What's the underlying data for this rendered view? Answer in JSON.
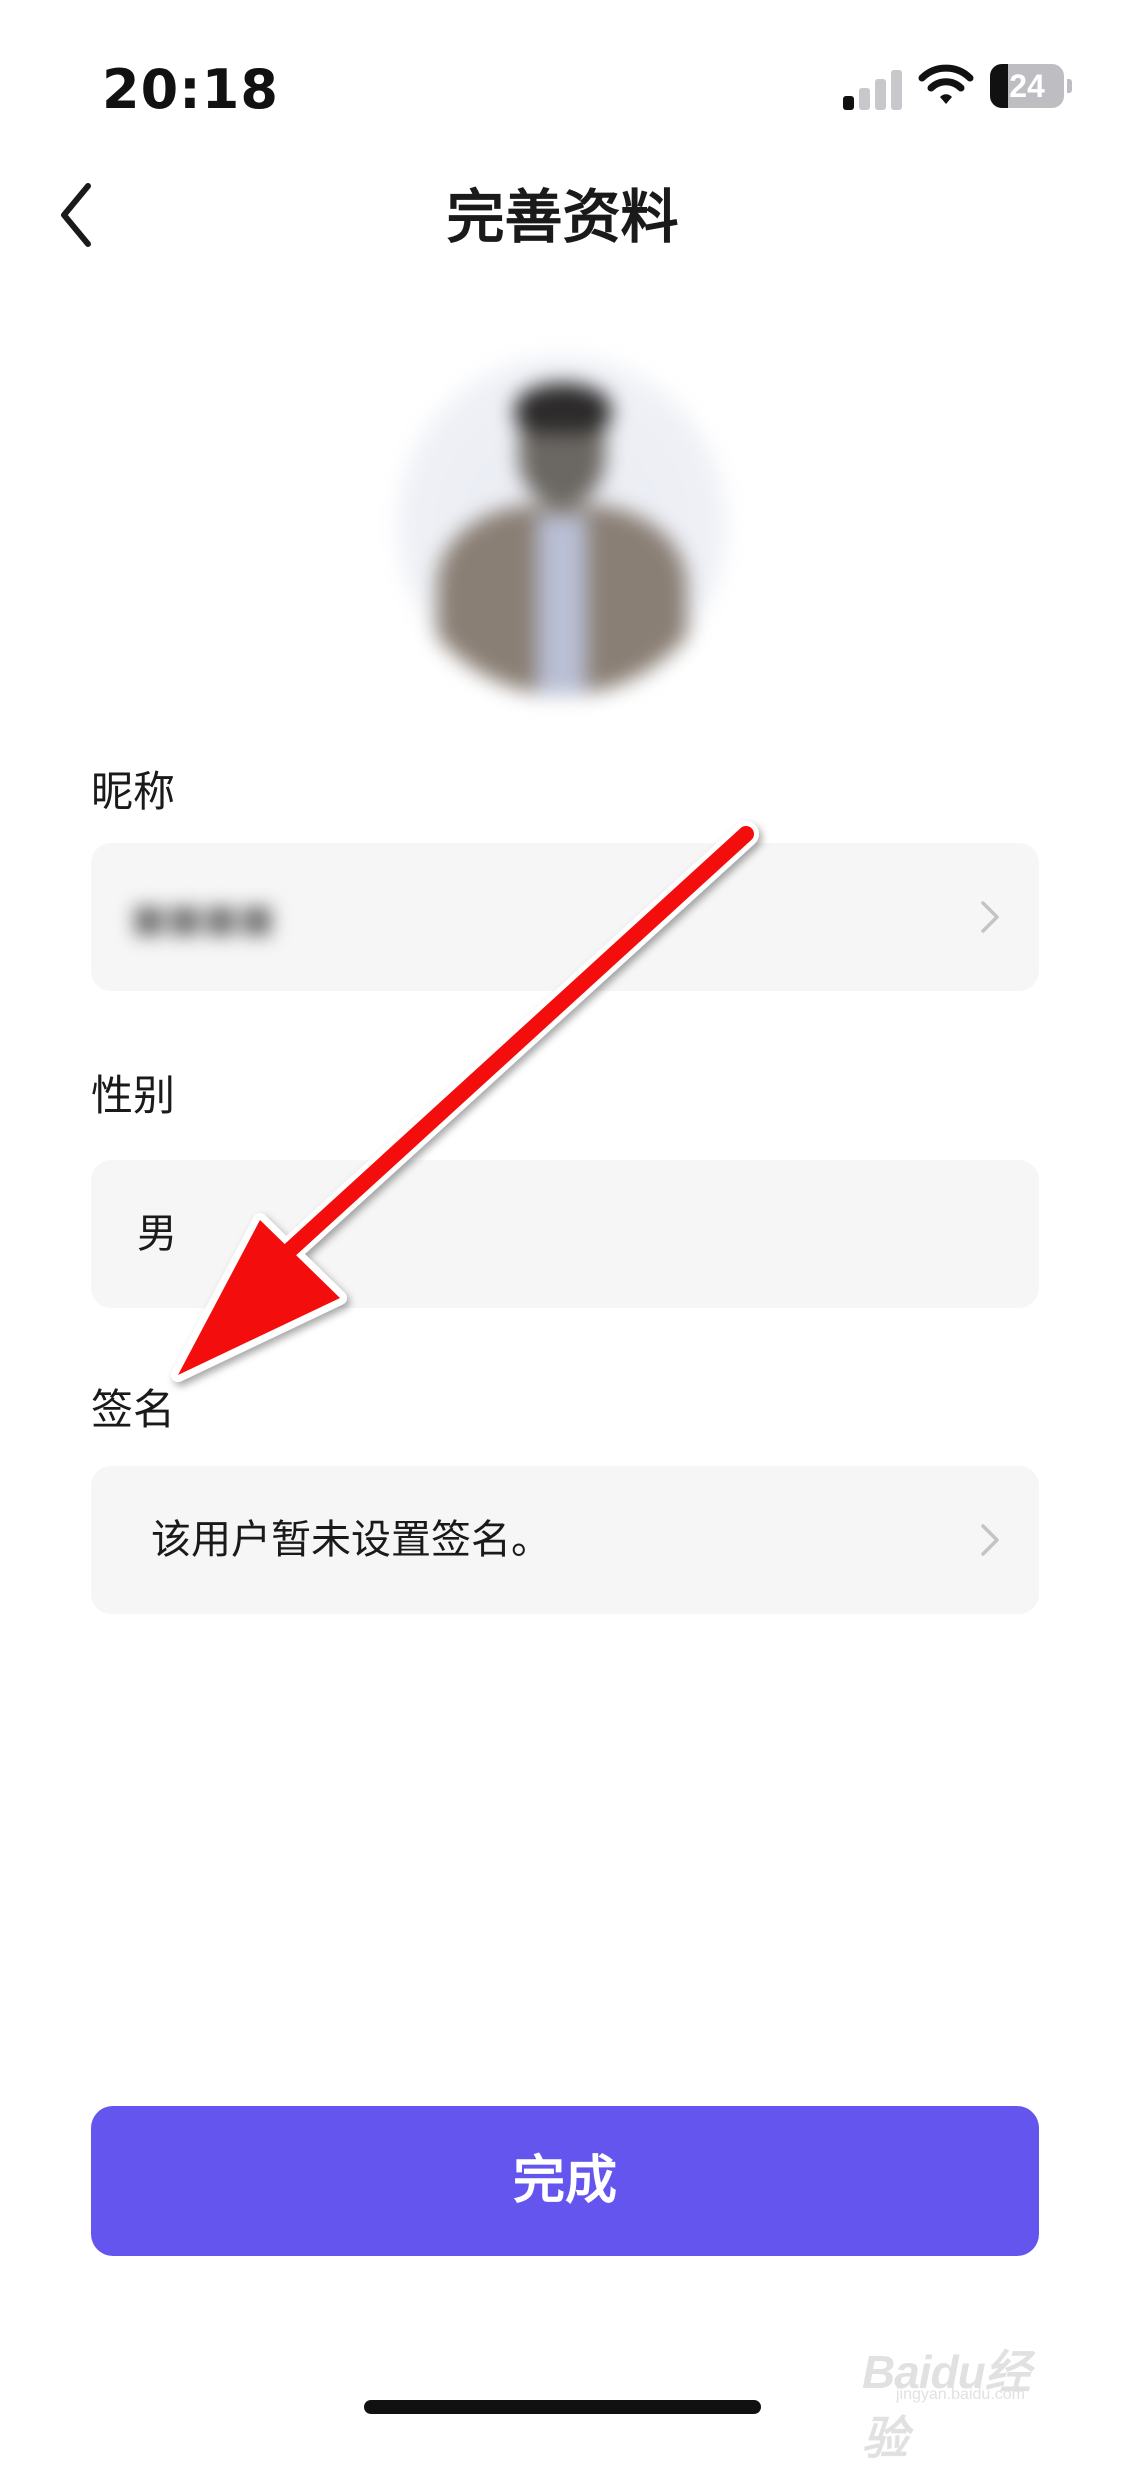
{
  "status_bar": {
    "time": "20:18",
    "battery": "24",
    "battery_level": 0.24,
    "signal_bars_active": 1,
    "signal_bars_total": 4
  },
  "header": {
    "title": "完善资料",
    "back_icon": "chevron-left-icon"
  },
  "form": {
    "nickname": {
      "label": "昵称",
      "value": ""
    },
    "gender": {
      "label": "性别",
      "value": "男"
    },
    "signature": {
      "label": "签名",
      "value": "该用户暂未设置签名。"
    }
  },
  "footer": {
    "done_label": "完成"
  },
  "watermark": {
    "logo": "Baidu经验",
    "sub": "jingyan.baidu.com"
  },
  "colors": {
    "accent": "#6555ef",
    "field_background": "#f6f6f6",
    "annotation_arrow": "#ff0000"
  }
}
